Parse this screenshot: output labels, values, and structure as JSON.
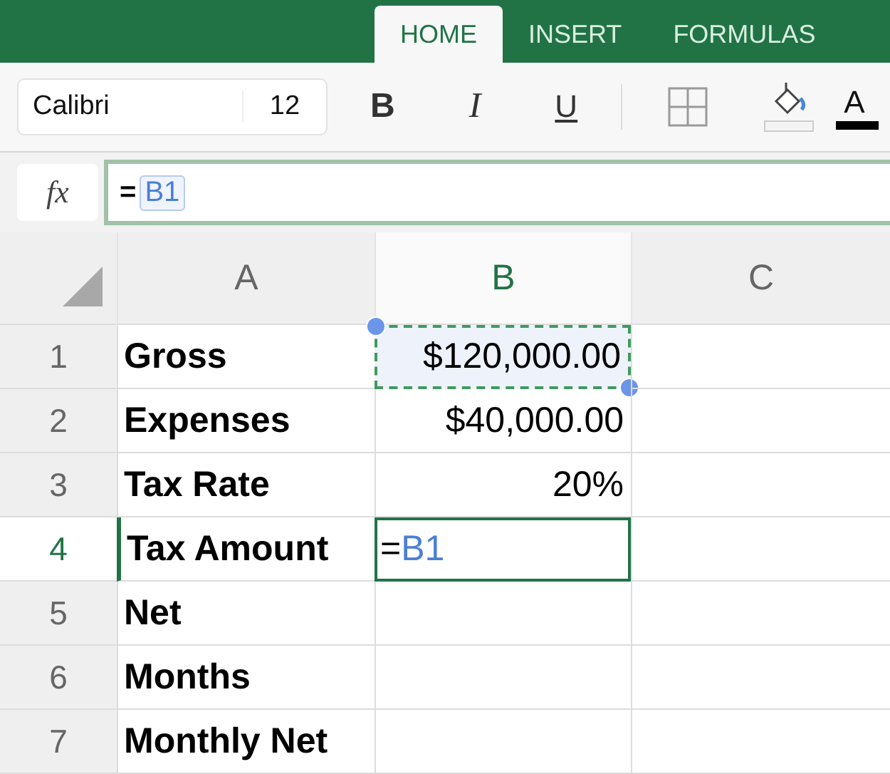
{
  "tabs": [
    {
      "label": "HOME",
      "selected": true
    },
    {
      "label": "INSERT",
      "selected": false
    },
    {
      "label": "FORMULAS",
      "selected": false
    }
  ],
  "toolbar": {
    "font": "Calibri",
    "size": "12",
    "bold": "B",
    "italic": "I",
    "underline": "U",
    "font_color": "A"
  },
  "formula_bar": {
    "fx": "fx",
    "formula": [
      {
        "text": "=",
        "kind": "operator"
      },
      {
        "text": "B1",
        "kind": "reference"
      }
    ]
  },
  "columns": [
    {
      "label": "A",
      "selected": false
    },
    {
      "label": "B",
      "selected": true
    },
    {
      "label": "C",
      "selected": false
    }
  ],
  "rows": [
    {
      "number": "1",
      "selected": false,
      "cells": [
        {
          "text": "Gross"
        },
        {
          "text": "$120,000.00",
          "referenced": true
        },
        {}
      ]
    },
    {
      "number": "2",
      "selected": false,
      "cells": [
        {
          "text": "Expenses"
        },
        {
          "text": "$40,000.00"
        },
        {}
      ]
    },
    {
      "number": "3",
      "selected": false,
      "cells": [
        {
          "text": "Tax Rate"
        },
        {
          "text": "20%"
        },
        {}
      ]
    },
    {
      "number": "4",
      "selected": true,
      "cells": [
        {
          "text": "Tax Amount"
        },
        {
          "active": true,
          "formula": [
            {
              "text": "=",
              "kind": "operator"
            },
            {
              "text": "B1",
              "kind": "reference"
            }
          ]
        },
        {}
      ]
    },
    {
      "number": "5",
      "selected": false,
      "cells": [
        {
          "text": "Net"
        },
        {},
        {}
      ]
    },
    {
      "number": "6",
      "selected": false,
      "cells": [
        {
          "text": "Months"
        },
        {},
        {}
      ]
    },
    {
      "number": "7",
      "selected": false,
      "cells": [
        {
          "text": "Monthly Net"
        },
        {},
        {}
      ]
    }
  ]
}
